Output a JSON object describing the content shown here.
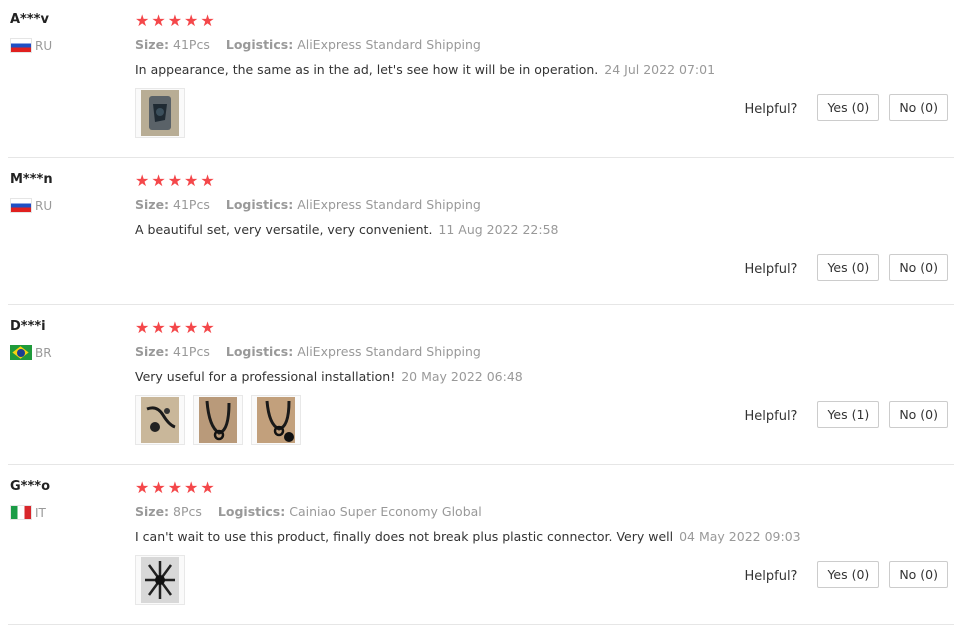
{
  "labels": {
    "size": "Size:",
    "logistics": "Logistics:",
    "helpful": "Helpful?"
  },
  "reviews": [
    {
      "user": "A***v",
      "country": "RU",
      "flag": "russia-flag",
      "stars": 5,
      "size": "41Pcs",
      "logistics": "AliExpress Standard Shipping",
      "text": "In appearance, the same as in the ad, let's see how it will be in operation.",
      "date": "24 Jul 2022 07:01",
      "yes": "Yes (0)",
      "no": "No (0)",
      "photos": 1
    },
    {
      "user": "M***n",
      "country": "RU",
      "flag": "russia-flag",
      "stars": 5,
      "size": "41Pcs",
      "logistics": "AliExpress Standard Shipping",
      "text": "A beautiful set, very versatile, very convenient.",
      "date": "11 Aug 2022 22:58",
      "yes": "Yes (0)",
      "no": "No (0)",
      "photos": 0
    },
    {
      "user": "D***i",
      "country": "BR",
      "flag": "brazil-flag",
      "stars": 5,
      "size": "41Pcs",
      "logistics": "AliExpress Standard Shipping",
      "text": "Very useful for a professional installation!",
      "date": "20 May 2022 06:48",
      "yes": "Yes (1)",
      "no": "No (0)",
      "photos": 3
    },
    {
      "user": "G***o",
      "country": "IT",
      "flag": "italy-flag",
      "stars": 5,
      "size": "8Pcs",
      "logistics": "Cainiao Super Economy Global",
      "text": "I can't wait to use this product, finally does not break plus plastic connector. Very well",
      "date": "04 May 2022 09:03",
      "yes": "Yes (0)",
      "no": "No (0)",
      "photos": 1
    }
  ],
  "colors": {
    "star": "#f4474a",
    "muted": "#999999",
    "text": "#333333",
    "border": "#cccccc"
  }
}
